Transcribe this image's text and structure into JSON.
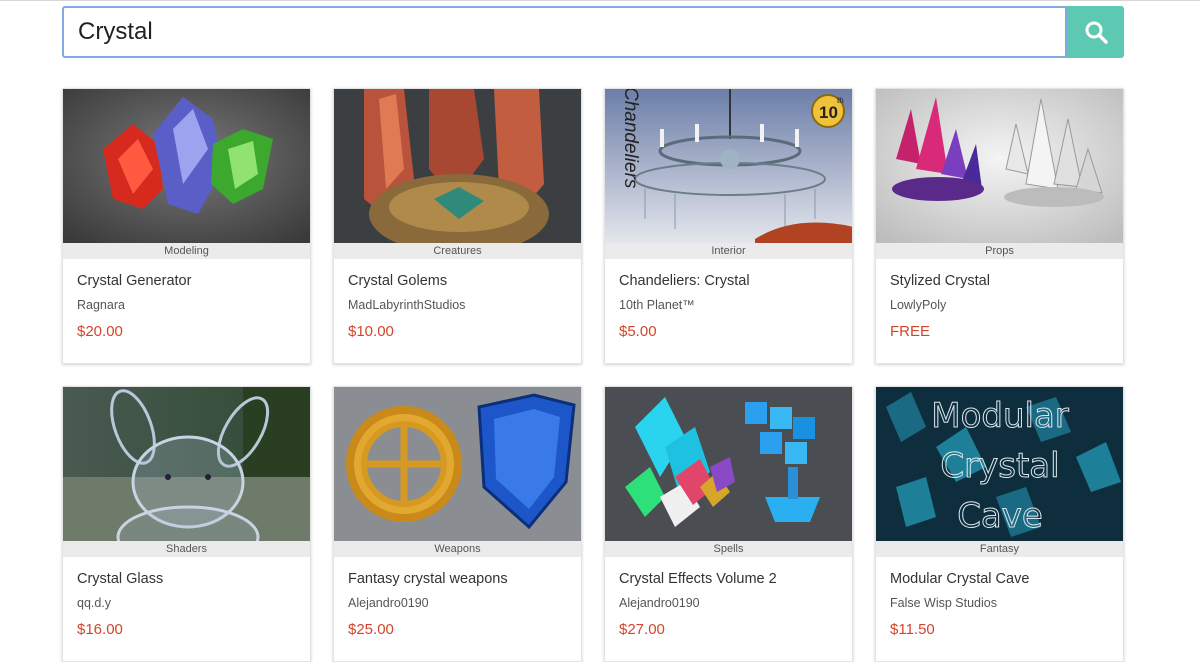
{
  "search": {
    "value": "Crystal",
    "button_icon": "search-icon",
    "accent_color": "#5dc9b3",
    "focus_border_color": "#82a9e0"
  },
  "price_color": "#d2452c",
  "products": [
    {
      "category": "Modeling",
      "title": "Crystal Generator",
      "author": "Ragnara",
      "price": "$20.00"
    },
    {
      "category": "Creatures",
      "title": "Crystal Golems",
      "author": "MadLabyrinthStudios",
      "price": "$10.00"
    },
    {
      "category": "Interior",
      "title": "Chandeliers: Crystal",
      "author": "10th Planet™",
      "price": "$5.00",
      "thumb_text": "Chandeliers",
      "badge": "10",
      "badge_sup": "th"
    },
    {
      "category": "Props",
      "title": "Stylized Crystal",
      "author": "LowlyPoly",
      "price": "FREE"
    },
    {
      "category": "Shaders",
      "title": "Crystal Glass",
      "author": "qq.d.y",
      "price": "$16.00"
    },
    {
      "category": "Weapons",
      "title": "Fantasy crystal weapons",
      "author": "Alejandro0190",
      "price": "$25.00"
    },
    {
      "category": "Spells",
      "title": "Crystal Effects Volume 2",
      "author": "Alejandro0190",
      "price": "$27.00"
    },
    {
      "category": "Fantasy",
      "title": "Modular Crystal Cave",
      "author": "False Wisp Studios",
      "price": "$11.50",
      "thumb_lines": [
        "Modular",
        "Crystal",
        "Cave"
      ]
    }
  ]
}
